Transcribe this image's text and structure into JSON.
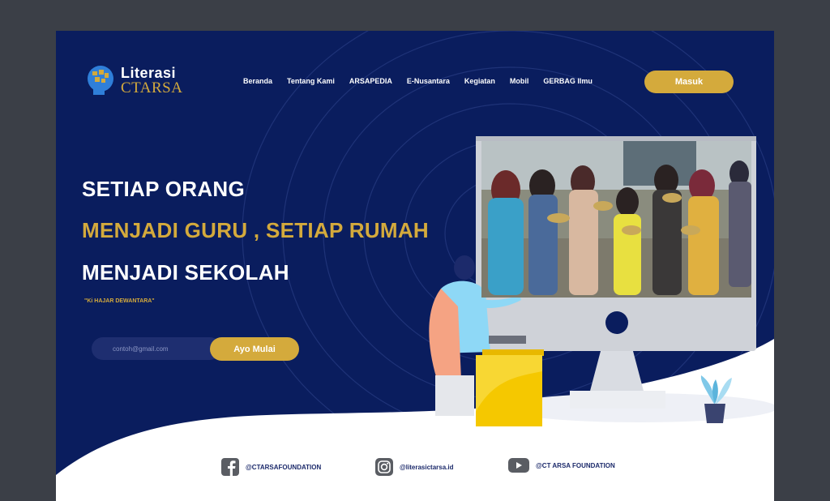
{
  "logo": {
    "top": "Literasi",
    "bottom": "CTARSA"
  },
  "nav": {
    "items": [
      "Beranda",
      "Tentang Kami",
      "ARSAPEDIA",
      "E-Nusantara",
      "Kegiatan",
      "Mobil",
      "GERBAG Ilmu"
    ]
  },
  "header": {
    "login_label": "Masuk"
  },
  "hero": {
    "line1": "SETIAP ORANG",
    "line2": "MENJADI GURU , SETIAP RUMAH",
    "line3": "MENJADI SEKOLAH",
    "quote": "\"Ki HAJAR DEWANTARA\""
  },
  "signup": {
    "placeholder": "contoh@gmail.com",
    "button_label": "Ayo Mulai"
  },
  "socials": {
    "facebook": "@CTARSAFOUNDATION",
    "instagram": "@literasictarsa.id",
    "youtube": "@CT ARSA FOUNDATION"
  },
  "colors": {
    "background": "#0a1d5e",
    "accent": "#d4aa3c",
    "page": "#3b3f47"
  }
}
